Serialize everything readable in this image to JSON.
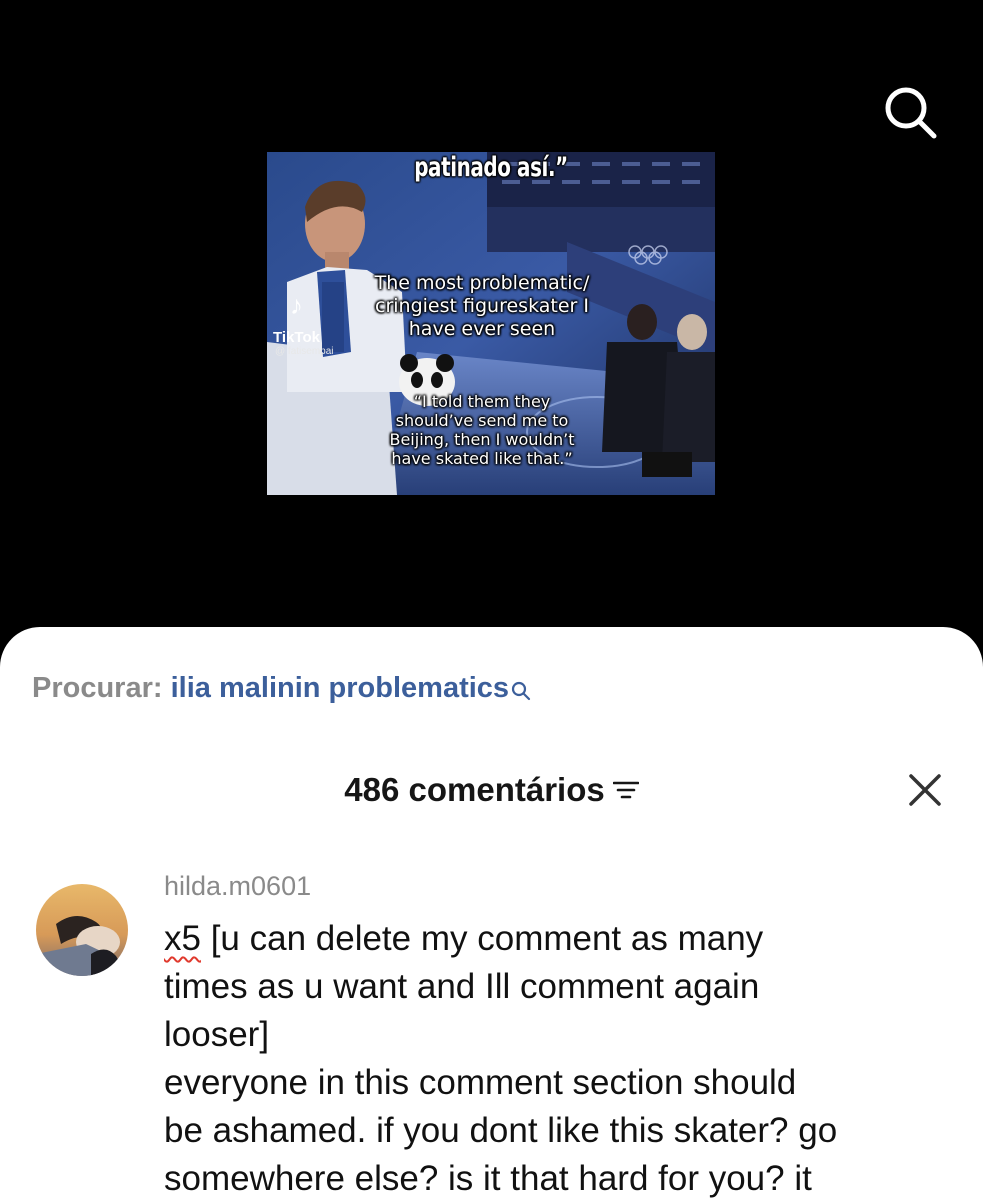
{
  "video": {
    "caption_top": "patinado así.”",
    "caption_main": "The most problematic/ cringiest figureskater I have ever seen",
    "caption_quote": "“I told them they should’ve send me to Beijing, then I wouldn’t have skated like that.”",
    "watermark": {
      "brand": "TikTok",
      "user": "@ fatisempai"
    },
    "search_icon": "search-icon"
  },
  "sheet": {
    "search": {
      "prefix": "Procurar:",
      "query": "ilia malinin problematics",
      "icon": "search-icon"
    },
    "header": {
      "count": "486 comentários",
      "sort_icon": "sort-icon",
      "close_icon": "close-icon"
    },
    "comment": {
      "username": "hilda.m0601",
      "lines": [
        "times as u want and Ill comment again",
        "looser]",
        "everyone in this comment section should",
        "be ashamed. if you dont like this skater? go",
        "somewhere else? is it that hard for you? it"
      ],
      "first_line_marked": "x5",
      "first_line_rest": " [u can delete my comment as many"
    }
  }
}
